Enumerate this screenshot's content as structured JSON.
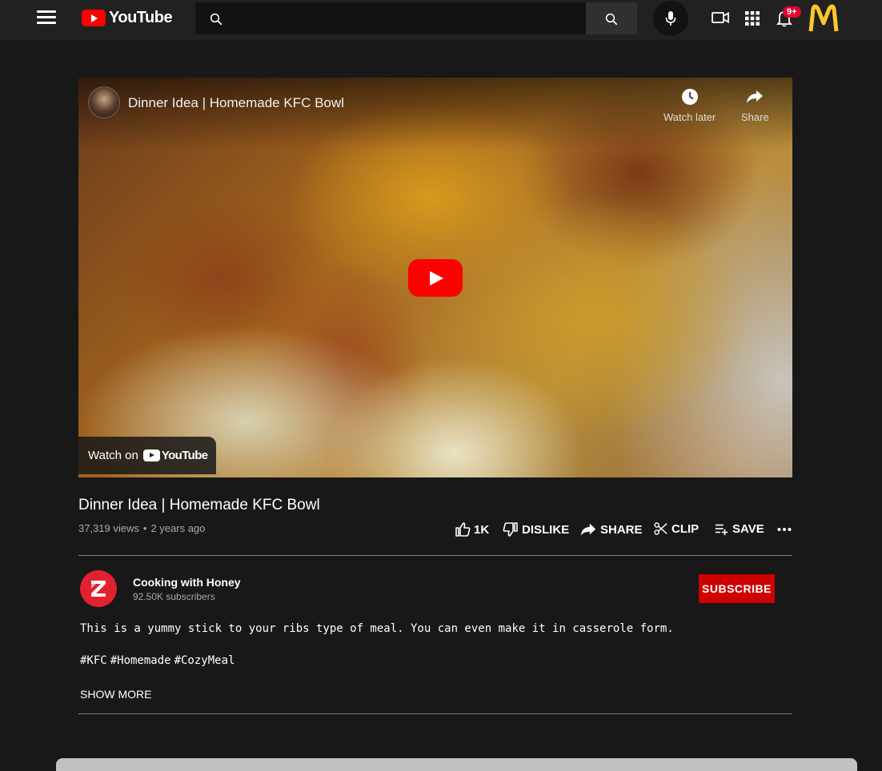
{
  "header": {
    "logo_text": "YouTube",
    "search_placeholder": "",
    "notification_badge": "9+"
  },
  "video": {
    "title": "Dinner Idea | Homemade KFC Bowl",
    "watch_later_label": "Watch later",
    "share_label": "Share",
    "watch_on_label": "Watch on",
    "watch_on_logo": "YouTube"
  },
  "info": {
    "title": "Dinner Idea | Homemade KFC Bowl",
    "views": "37,319 views",
    "date": "2 years ago",
    "actions": {
      "like": "1K",
      "dislike": "DISLIKE",
      "share": "SHARE",
      "clip": "CLIP",
      "save": "SAVE"
    }
  },
  "channel": {
    "name": "Cooking with Honey",
    "subscribers": "92.50K subscribers",
    "subscribe_label": "SUBSCRIBE"
  },
  "description": {
    "text": "This is a yummy stick to your ribs type of meal. You can even make it in casserole form.",
    "tags": [
      "#KFC",
      "#Homemade",
      "#CozyMeal"
    ],
    "show_more": "SHOW MORE"
  },
  "colors": {
    "background": "#181818",
    "topbar": "#212121",
    "brand_red": "#ff0000",
    "subscribe": "#cc0000"
  }
}
